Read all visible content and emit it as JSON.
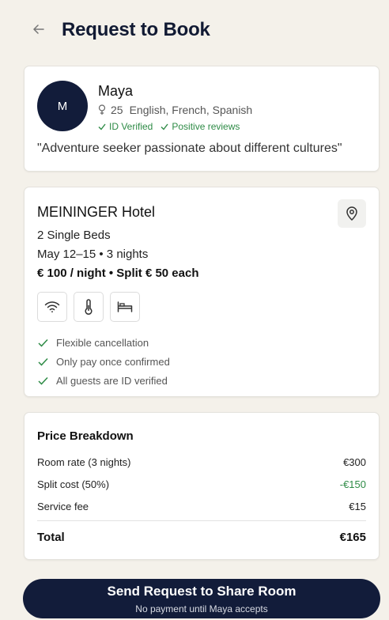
{
  "header": {
    "title": "Request to Book",
    "back_icon": "arrow-left-icon"
  },
  "host": {
    "initial": "M",
    "name": "Maya",
    "age": "25",
    "languages": "English, French, Spanish",
    "badges": [
      "ID Verified",
      "Positive reviews"
    ],
    "quote": "\"Adventure seeker passionate about different cultures\""
  },
  "hotel": {
    "name": "MEININGER Hotel",
    "beds": "2 Single Beds",
    "dates": "May 12–15 • 3 nights",
    "price": "€ 100 / night • Split € 50 each",
    "amenities": [
      "wifi-icon",
      "thermometer-icon",
      "bed-icon"
    ],
    "perks": [
      "Flexible cancellation",
      "Only pay once confirmed",
      "All guests are ID verified"
    ]
  },
  "price_breakdown": {
    "title": "Price Breakdown",
    "rows": [
      {
        "label": "Room rate (3 nights)",
        "value": "€300"
      },
      {
        "label": "Split cost (50%)",
        "value": "-€150"
      },
      {
        "label": "Service fee",
        "value": "€15"
      }
    ],
    "total_label": "Total",
    "total_value": "€165"
  },
  "cta": {
    "label": "Send Request to Share Room",
    "sublabel": "No payment until Maya accepts"
  },
  "colors": {
    "primary": "#121c3a",
    "success": "#2e8b46",
    "background": "#f4f1ea"
  }
}
